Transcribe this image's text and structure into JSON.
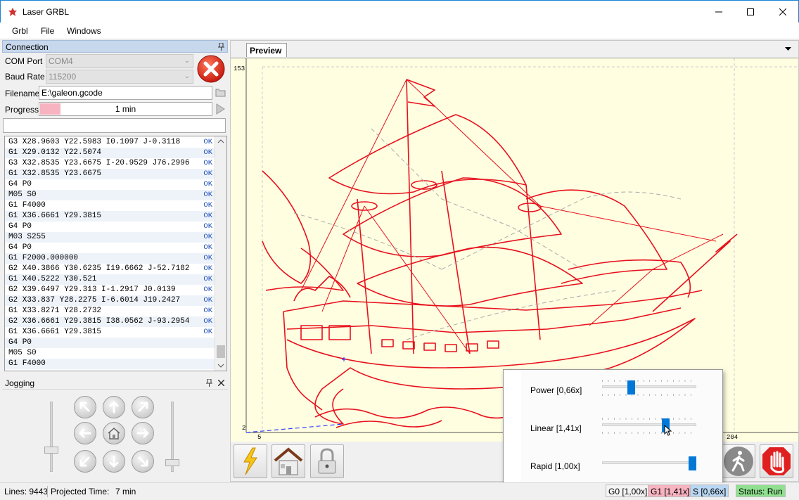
{
  "window": {
    "title": "Laser GRBL"
  },
  "menu": {
    "items": [
      "Grbl",
      "File",
      "Windows"
    ]
  },
  "connection": {
    "header": "Connection",
    "com_port_label": "COM Port",
    "com_port_value": "COM4",
    "baud_rate_label": "Baud Rate",
    "baud_rate_value": "115200",
    "filename_label": "Filename",
    "filename_value": "E:\\galeon.gcode",
    "progress_label": "Progress",
    "progress_text": "1 min",
    "progress_fraction": 0.12
  },
  "command_input": {
    "value": ""
  },
  "log": [
    {
      "cmd": "G3 X28.9603 Y22.5983 I0.1097 J-0.3118",
      "status": "OK"
    },
    {
      "cmd": "G1 X29.0132 Y22.5074",
      "status": "OK"
    },
    {
      "cmd": "G3 X32.8535 Y23.6675 I-20.9529 J76.2996",
      "status": "OK"
    },
    {
      "cmd": "G1 X32.8535 Y23.6675",
      "status": "OK"
    },
    {
      "cmd": "G4 P0",
      "status": "OK"
    },
    {
      "cmd": "M05 S0",
      "status": "OK"
    },
    {
      "cmd": "G1 F4000",
      "status": "OK"
    },
    {
      "cmd": "G1 X36.6661 Y29.3815",
      "status": "OK"
    },
    {
      "cmd": "G4 P0",
      "status": "OK"
    },
    {
      "cmd": "M03 S255",
      "status": "OK"
    },
    {
      "cmd": "G4 P0",
      "status": "OK"
    },
    {
      "cmd": "G1 F2000.000000",
      "status": "OK"
    },
    {
      "cmd": "G2 X40.3866 Y30.6235 I19.6662 J-52.7182",
      "status": "OK"
    },
    {
      "cmd": "G1 X40.5222 Y30.521",
      "status": "OK"
    },
    {
      "cmd": "G2 X39.6497 Y29.313 I-1.2917 J0.0139",
      "status": "OK"
    },
    {
      "cmd": "G2 X33.837 Y28.2275 I-6.6014 J19.2427",
      "status": "OK"
    },
    {
      "cmd": "G1 X33.8271 Y28.2732",
      "status": "OK"
    },
    {
      "cmd": "G2 X36.6661 Y29.3815 I38.0562 J-93.2954",
      "status": "OK"
    },
    {
      "cmd": "G1 X36.6661 Y29.3815",
      "status": "OK"
    },
    {
      "cmd": "G4 P0",
      "status": ""
    },
    {
      "cmd": "M05 S0",
      "status": ""
    },
    {
      "cmd": "G1 F4000",
      "status": ""
    }
  ],
  "jogging": {
    "header": "Jogging"
  },
  "preview": {
    "tab_label": "Preview",
    "axis_y_max": "153",
    "axis_y_min": "2",
    "axis_x_min": "5",
    "axis_x_max": "204"
  },
  "overrides": {
    "power_label": "Power [0,66x]",
    "power_value": 0.66,
    "linear_label": "Linear [1,41x]",
    "linear_value": 1.41,
    "rapid_label": "Rapid [1,00x]",
    "rapid_value": 1.0
  },
  "status": {
    "lines": "Lines: 9443",
    "projected": "Projected Time:",
    "projected_value": "7 min",
    "g0": "G0 [1,00x]",
    "g1": "G1 [1,41x]",
    "s": "S [0,66x]",
    "state": "Status: Run"
  },
  "colors": {
    "accent_blue": "#0078d7",
    "drawing_red": "#e8101c",
    "canvas_bg": "#fffee1",
    "status_run_bg": "#8fe08f",
    "g1_bg": "#f7b3c0",
    "s_bg": "#b9d7f3"
  }
}
